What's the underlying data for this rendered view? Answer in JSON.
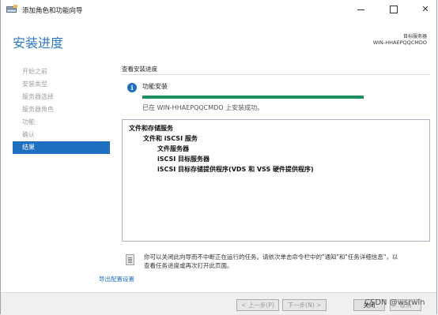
{
  "window": {
    "title": "添加角色和功能向导",
    "controls": {
      "minimize": "minimize",
      "maximize": "maximize",
      "close": "✕"
    }
  },
  "header": {
    "title": "安装进度",
    "server_label": "目标服务器",
    "server_name": "WIN-HHAEPQQCMDO"
  },
  "sidebar": {
    "items": [
      {
        "label": "开始之前",
        "active": false
      },
      {
        "label": "安装类型",
        "active": false
      },
      {
        "label": "服务器选择",
        "active": false
      },
      {
        "label": "服务器角色",
        "active": false
      },
      {
        "label": "功能",
        "active": false
      },
      {
        "label": "确认",
        "active": false
      },
      {
        "label": "结果",
        "active": true
      }
    ]
  },
  "main": {
    "section_title": "查看安装进度",
    "status_label": "功能安装",
    "progress_fraction": 1.0,
    "result_text": "已在 WIN-HHAEPQQCMDO 上安装成功。",
    "features": [
      {
        "label": "文件和存储服务",
        "level": 0
      },
      {
        "label": "文件和 iSCSI 服务",
        "level": 1
      },
      {
        "label": "文件服务器",
        "level": 2
      },
      {
        "label": "iSCSI 目标服务器",
        "level": 2
      },
      {
        "label": "iSCSI 目标存储提供程序(VDS 和 VSS 硬件提供程序)",
        "level": 2
      }
    ],
    "note_line1": "你可以关闭此向导而不中断正在运行的任务。请依次单击命令栏中的\"通知\"和\"任务详细信息\"，以",
    "note_line2": "查看任务进度或再次打开此页面。",
    "export_link": "导出配置设置"
  },
  "footer": {
    "prev_label": "< 上一步(P)",
    "next_label": "下一步(N) >",
    "close_label": "关闭",
    "cancel_label": "取消",
    "watermark": "CSDN @wsrwln"
  }
}
